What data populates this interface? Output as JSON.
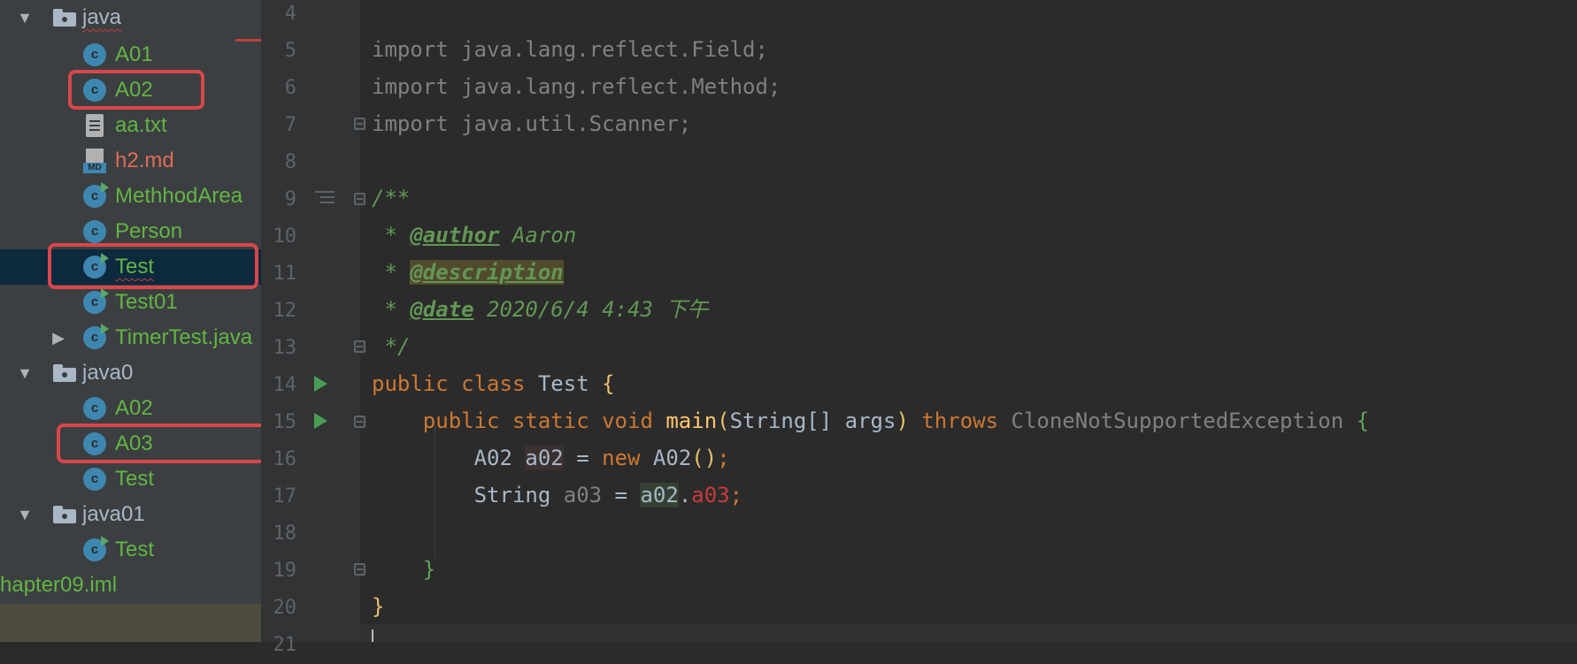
{
  "project_tree": {
    "rows": [
      {
        "label": "java",
        "type": "folder",
        "expanded": true
      },
      {
        "label": "A01",
        "type": "class"
      },
      {
        "label": "A02",
        "type": "class",
        "highlighted": true
      },
      {
        "label": "aa.txt",
        "type": "text-file"
      },
      {
        "label": "h2.md",
        "type": "markdown-file"
      },
      {
        "label": "MethhodArea",
        "type": "runnable-class"
      },
      {
        "label": "Person",
        "type": "class"
      },
      {
        "label": "Test",
        "type": "runnable-class",
        "selected": true,
        "highlighted": true
      },
      {
        "label": "Test01",
        "type": "runnable-class"
      },
      {
        "label": "TimerTest.java",
        "type": "runnable-class",
        "collapsed": true
      },
      {
        "label": "java0",
        "type": "folder",
        "expanded": true
      },
      {
        "label": "A02",
        "type": "class"
      },
      {
        "label": "A03",
        "type": "class",
        "highlighted": true
      },
      {
        "label": "Test",
        "type": "class"
      },
      {
        "label": "java01",
        "type": "folder",
        "expanded": true
      },
      {
        "label": "Test",
        "type": "runnable-class"
      },
      {
        "label": "hapter09.iml",
        "type": "module-file"
      }
    ],
    "class_icon_letter": "c",
    "markdown_badge": "MD",
    "expanded_arrow": "▼",
    "collapsed_arrow": "▶"
  },
  "editor": {
    "line_numbers": [
      "4",
      "5",
      "6",
      "7",
      "8",
      "9",
      "10",
      "11",
      "12",
      "13",
      "14",
      "15",
      "16",
      "17",
      "18",
      "19",
      "20",
      "21"
    ],
    "lines": {
      "l5": {
        "kw": "import",
        "rest": " java.lang.reflect.Field;"
      },
      "l6": {
        "kw": "import",
        "rest": " java.lang.reflect.Method;"
      },
      "l7": {
        "kw": "import",
        "rest": " java.util.Scanner;"
      },
      "l9": {
        "text": "/**"
      },
      "l10": {
        "star": " * ",
        "tag": "@author",
        "value": " Aaron"
      },
      "l11": {
        "star": " * ",
        "tag": "@description"
      },
      "l12": {
        "star": " * ",
        "tag": "@date",
        "value": " 2020/6/4 4:43 下午"
      },
      "l13": {
        "text": " */"
      },
      "l14": {
        "kw1": "public",
        "kw2": " class",
        "name": " Test",
        "brace": " {"
      },
      "l15": {
        "kw1": "public",
        "kw2": " static",
        "kw3": " void",
        "fn": " main",
        "open": "(",
        "type": "String[]",
        "param": " args",
        "close": ")",
        "throws": " throws",
        "exc": " CloneNotSupportedException",
        "brace": " {"
      },
      "l16": {
        "type": "A02",
        "var": "a02",
        "eq": " = ",
        "kw": "new",
        "ctor": " A02",
        "parens": "()",
        "semi": ";"
      },
      "l17": {
        "type": "String",
        "var": " a03",
        "eq": " = ",
        "obj": "a02",
        "dot": ".",
        "field": "a03",
        "semi": ";"
      },
      "l19": {
        "brace": "}"
      },
      "l20": {
        "brace": "}"
      }
    }
  },
  "colors": {
    "sidebar_bg": "#3c3f41",
    "editor_bg": "#2b2b2b",
    "highlight_border": "#d9474a",
    "selection_bg": "#0d293e",
    "class_icon": "#3d87b1",
    "green_label": "#62b543",
    "red_label": "#e06c57"
  }
}
